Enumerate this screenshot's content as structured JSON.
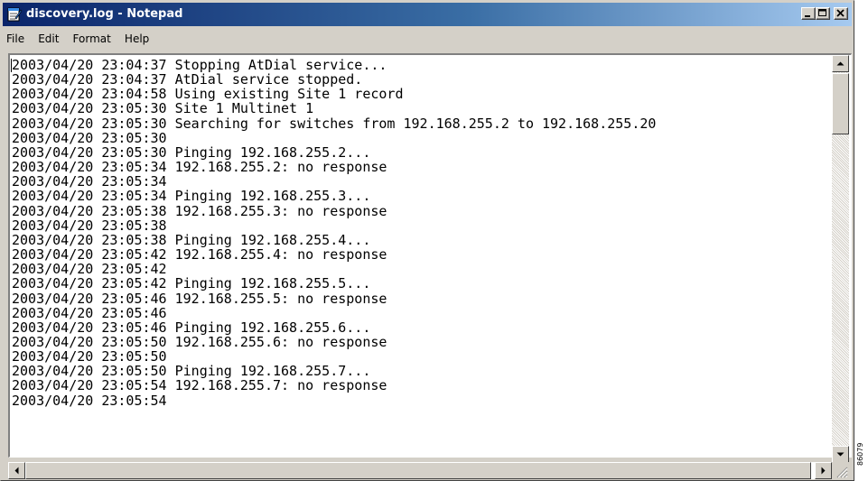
{
  "window": {
    "title": "discovery.log - Notepad",
    "app_icon": "notepad-icon",
    "controls": [
      "minimize-icon",
      "maximize-icon",
      "close-icon"
    ]
  },
  "menu": {
    "items": [
      {
        "label": "File"
      },
      {
        "label": "Edit"
      },
      {
        "label": "Format"
      },
      {
        "label": "Help"
      }
    ]
  },
  "document": {
    "lines": [
      "2003/04/20 23:04:37 Stopping AtDial service...",
      "2003/04/20 23:04:37 AtDial service stopped.",
      "2003/04/20 23:04:58 Using existing Site 1 record",
      "2003/04/20 23:05:30 Site 1 Multinet 1",
      "2003/04/20 23:05:30 Searching for switches from 192.168.255.2 to 192.168.255.20",
      "2003/04/20 23:05:30",
      "2003/04/20 23:05:30 Pinging 192.168.255.2...",
      "2003/04/20 23:05:34 192.168.255.2: no response",
      "2003/04/20 23:05:34",
      "2003/04/20 23:05:34 Pinging 192.168.255.3...",
      "2003/04/20 23:05:38 192.168.255.3: no response",
      "2003/04/20 23:05:38",
      "2003/04/20 23:05:38 Pinging 192.168.255.4...",
      "2003/04/20 23:05:42 192.168.255.4: no response",
      "2003/04/20 23:05:42",
      "2003/04/20 23:05:42 Pinging 192.168.255.5...",
      "2003/04/20 23:05:46 192.168.255.5: no response",
      "2003/04/20 23:05:46",
      "2003/04/20 23:05:46 Pinging 192.168.255.6...",
      "2003/04/20 23:05:50 192.168.255.6: no response",
      "2003/04/20 23:05:50",
      "2003/04/20 23:05:50 Pinging 192.168.255.7...",
      "2003/04/20 23:05:54 192.168.255.7: no response",
      "2003/04/20 23:05:54"
    ]
  },
  "figure_id": "86079",
  "colors": {
    "titlebar_start": "#0a246a",
    "titlebar_end": "#a6caf0",
    "chrome": "#d4d0c8"
  }
}
